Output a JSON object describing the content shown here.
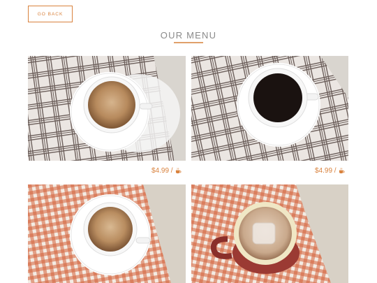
{
  "nav": {
    "back_label": "GO BACK"
  },
  "page": {
    "title": "OUR MENU"
  },
  "menu": {
    "items": [
      {
        "price": "$4.99 /",
        "drink": "latte",
        "cloth": "gray plaid",
        "icon": "coffee-cup-icon"
      },
      {
        "price": "$4.99 /",
        "drink": "black coffee",
        "cloth": "gray plaid",
        "icon": "coffee-cup-icon"
      },
      {
        "drink": "latte",
        "cloth": "orange gingham"
      },
      {
        "drink": "iced drink",
        "cloth": "orange gingham"
      }
    ]
  },
  "colors": {
    "accent": "#d9823d",
    "divider": "#e0a06a",
    "plaid_line": "#6b5e5a",
    "gingham": "#d2623a"
  }
}
